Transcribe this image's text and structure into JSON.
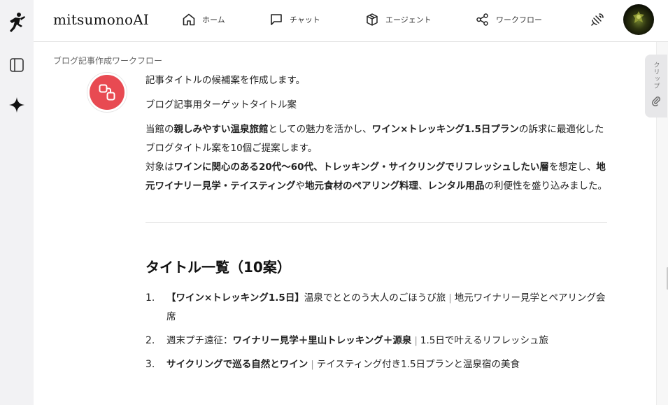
{
  "app": {
    "brand": "mitsumonoAI"
  },
  "nav": {
    "home": "ホーム",
    "chat": "チャット",
    "agent": "エージェント",
    "workflow": "ワークフロー"
  },
  "breadcrumb": "ブログ記事作成ワークフロー",
  "clip_tab": {
    "label": "クリップ"
  },
  "message": {
    "line1": "記事タイトルの候補案を作成します。",
    "line2": "ブログ記事用ターゲットタイトル案",
    "p1": [
      {
        "t": "当館の",
        "b": false
      },
      {
        "t": "親しみやすい温泉旅館",
        "b": true
      },
      {
        "t": "としての魅力を活かし、",
        "b": false
      },
      {
        "t": "ワイン×トレッキング1.5日プラン",
        "b": true
      },
      {
        "t": "の訴求に最適化したブログタイトル案を10個ご提案します。",
        "b": false
      },
      {
        "br": true
      },
      {
        "t": "対象は",
        "b": false
      },
      {
        "t": "ワインに関心のある20代〜60代、トレッキング・サイクリングでリフレッシュしたい層",
        "b": true
      },
      {
        "t": "を想定し、",
        "b": false
      },
      {
        "t": "地元ワイナリー見学・テイスティング",
        "b": true
      },
      {
        "t": "や",
        "b": false
      },
      {
        "t": "地元食材のペアリング料理",
        "b": true
      },
      {
        "t": "、",
        "b": false
      },
      {
        "t": "レンタル用品",
        "b": true
      },
      {
        "t": "の利便性を盛り込みました。",
        "b": false
      }
    ],
    "heading": "タイトル一覧（10案）",
    "titles": [
      {
        "num": "1.",
        "parts": [
          {
            "t": "【ワイン×トレッキング1.5日】",
            "b": true
          },
          {
            "t": "温泉でととのう大人のごほうび旅",
            "b": false
          },
          {
            "t": "|",
            "sep": true
          },
          {
            "t": "地元ワイナリー見学とペアリング会席",
            "b": false
          }
        ]
      },
      {
        "num": "2.",
        "parts": [
          {
            "t": "週末プチ遠征：",
            "b": false
          },
          {
            "t": "ワイナリー見学＋里山トレッキング＋源泉",
            "b": true
          },
          {
            "t": "|",
            "sep": true
          },
          {
            "t": "1.5日で叶えるリフレッシュ旅",
            "b": false
          }
        ]
      },
      {
        "num": "3.",
        "parts": [
          {
            "t": "サイクリングで巡る自然とワイン",
            "b": true
          },
          {
            "t": "|",
            "sep": true
          },
          {
            "t": "テイスティング付き1.5日プランと温泉宿の美食",
            "b": false
          }
        ]
      }
    ]
  },
  "colors": {
    "sidebar_bg": "#f2f2f4",
    "bot_avatar": "#e84a52",
    "text": "#222222",
    "muted": "#666666"
  },
  "icons": {
    "logo": "runner-icon",
    "panel": "sidebar-toggle-icon",
    "sparkle": "sparkle-icon",
    "home": "home-icon",
    "chat": "chat-bubble-icon",
    "agent": "cube-icon",
    "workflow": "share-nodes-icon",
    "broadcast": "satellite-icon",
    "clip": "paperclip-icon",
    "bot": "workflow-nodes-icon"
  }
}
